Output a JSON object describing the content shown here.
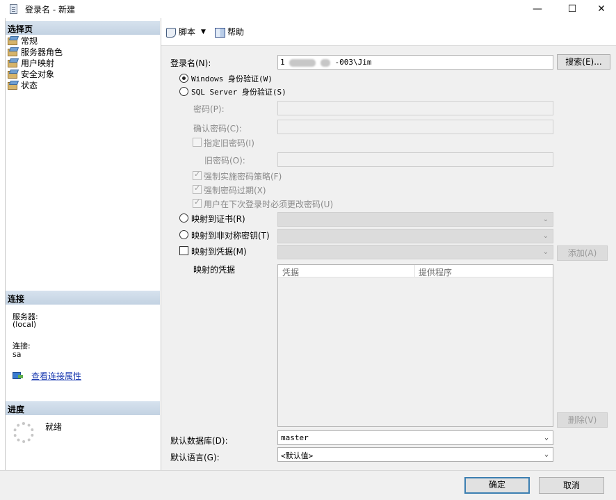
{
  "window": {
    "title": "登录名 - 新建",
    "minimize": "—",
    "maximize": "☐",
    "close": "✕"
  },
  "left": {
    "select_page_header": "选择页",
    "pages": [
      {
        "label": "常规"
      },
      {
        "label": "服务器角色"
      },
      {
        "label": "用户映射"
      },
      {
        "label": "安全对象"
      },
      {
        "label": "状态"
      }
    ],
    "connection_header": "连接",
    "server_label": "服务器:",
    "server_value": "(local)",
    "connection_label": "连接:",
    "connection_value": "sa",
    "view_connection_link": "查看连接属性",
    "progress_header": "进度",
    "progress_status": "就绪"
  },
  "toolbar": {
    "script_label": "脚本",
    "help_label": "帮助"
  },
  "form": {
    "login_name_label": "登录名(N):",
    "login_name_prefix": "1",
    "login_name_suffix": "-003\\Jim",
    "search_button": "搜索(E)...",
    "windows_auth_label": "Windows 身份验证(W)",
    "sql_auth_label": "SQL Server 身份验证(S)",
    "password_label": "密码(P):",
    "confirm_password_label": "确认密码(C):",
    "specify_old_password_label": "指定旧密码(I)",
    "old_password_label": "旧密码(O):",
    "enforce_policy_label": "强制实施密码策略(F)",
    "enforce_expiration_label": "强制密码过期(X)",
    "must_change_label": "用户在下次登录时必须更改密码(U)",
    "map_certificate_label": "映射到证书(R)",
    "map_asymmetric_key_label": "映射到非对称密钥(T)",
    "map_credential_label": "映射到凭据(M)",
    "add_button": "添加(A)",
    "mapped_credentials_label": "映射的凭据",
    "grid_columns": [
      "凭据",
      "提供程序"
    ],
    "remove_button": "删除(V)",
    "default_database_label": "默认数据库(D):",
    "default_database_value": "master",
    "default_language_label": "默认语言(G):",
    "default_language_value": "<默认值>"
  },
  "footer": {
    "ok_button": "确定",
    "cancel_button": "取消"
  }
}
